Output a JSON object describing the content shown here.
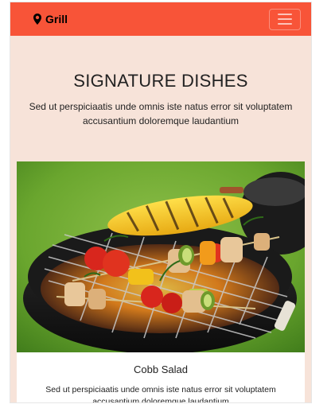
{
  "navbar": {
    "brand": "Grill",
    "brand_icon": "map-marker-icon",
    "toggler_icon": "hamburger-menu-icon",
    "color": "#f85438"
  },
  "hero": {
    "title": "SIGNATURE DISHES",
    "subtitle": "Sed ut perspiciaatis unde omnis iste natus error sit voluptatem accusantium doloremque laudantium",
    "background": "#f7e3d9"
  },
  "card": {
    "image": "grilled-corn-and-skewers-photo",
    "title": "Cobb Salad",
    "text": "Sed ut perspiciaatis unde omnis iste natus error sit voluptatem accusantium doloremque laudantium"
  }
}
